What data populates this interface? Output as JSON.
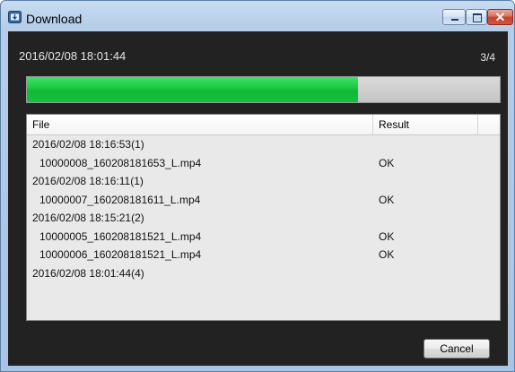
{
  "window": {
    "title": "Download",
    "icons": {
      "app": "download-window-icon",
      "minimize": "minimize-icon",
      "maximize": "maximize-icon",
      "close": "close-icon"
    },
    "close_glyph": "✕",
    "colors": {
      "frame": "#b5cde8",
      "client_bg": "#222222",
      "close_button": "#c5432b"
    }
  },
  "header": {
    "datetime": "2016/02/08 18:01:44",
    "counter": "3/4"
  },
  "progress": {
    "fraction": 0.7,
    "color": "#18c93f"
  },
  "list": {
    "columns": [
      "File",
      "Result",
      ""
    ],
    "rows": [
      {
        "file": "2016/02/08 18:16:53(1)",
        "result": "",
        "child": false
      },
      {
        "file": "10000008_160208181653_L.mp4",
        "result": "OK",
        "child": true
      },
      {
        "file": "2016/02/08 18:16:11(1)",
        "result": "",
        "child": false
      },
      {
        "file": "10000007_160208181611_L.mp4",
        "result": "OK",
        "child": true
      },
      {
        "file": "2016/02/08 18:15:21(2)",
        "result": "",
        "child": false
      },
      {
        "file": "10000005_160208181521_L.mp4",
        "result": "OK",
        "child": true
      },
      {
        "file": "10000006_160208181521_L.mp4",
        "result": "OK",
        "child": true
      },
      {
        "file": "2016/02/08 18:01:44(4)",
        "result": "",
        "child": false
      }
    ]
  },
  "footer": {
    "cancel_label": "Cancel"
  }
}
